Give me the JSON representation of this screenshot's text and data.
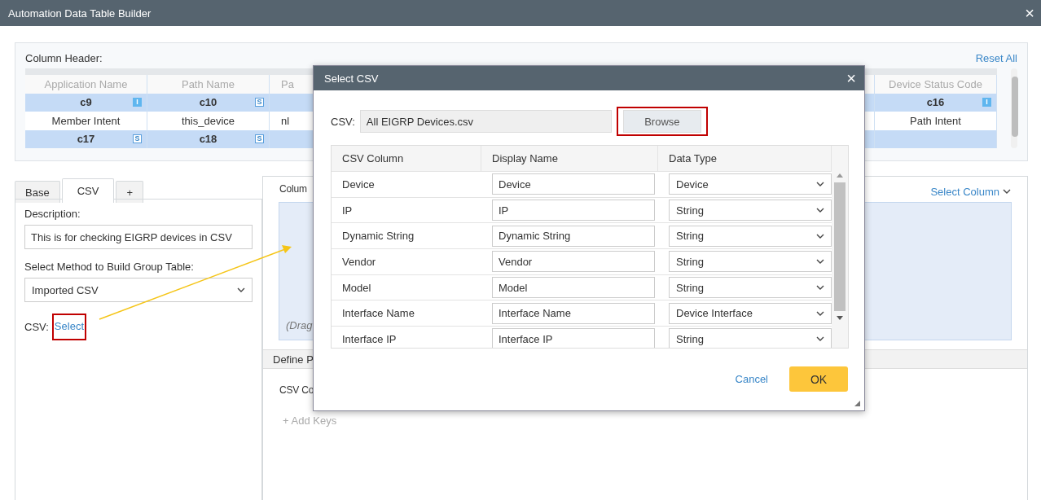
{
  "window": {
    "title": "Automation Data Table Builder",
    "close": "×"
  },
  "column_header": {
    "label": "Column Header:",
    "reset": "Reset All",
    "rows": [
      {
        "kind": "name",
        "cells": [
          {
            "text": "Application Name"
          },
          {
            "text": "Path Name"
          },
          {
            "text": "Pa"
          },
          {
            "text": "Device Status Code"
          }
        ]
      },
      {
        "kind": "var",
        "cells": [
          {
            "text": "c9",
            "badge": "I"
          },
          {
            "text": "c10",
            "badge": "S"
          },
          {
            "text": ""
          },
          {
            "text": "c16",
            "badge": "I"
          }
        ]
      },
      {
        "kind": "value",
        "cells": [
          {
            "text": "Member Intent"
          },
          {
            "text": "this_device"
          },
          {
            "text": "nl"
          },
          {
            "text": "Path Intent"
          }
        ]
      },
      {
        "kind": "var",
        "cells": [
          {
            "text": "c17",
            "badge": "S"
          },
          {
            "text": "c18",
            "badge": "S"
          },
          {
            "text": ""
          },
          {
            "text": ""
          }
        ]
      }
    ]
  },
  "tabs": [
    {
      "label": "Base",
      "selected": false
    },
    {
      "label": "CSV",
      "selected": true
    },
    {
      "label": "+",
      "selected": false
    }
  ],
  "form": {
    "description_label": "Description:",
    "description": "This is for checking EIGRP devices in CSV",
    "method_label": "Select Method to Build Group Table:",
    "method": "Imported CSV",
    "csv_label": "CSV:",
    "csv_link": "Select",
    "csv_link_highlighted": true
  },
  "right_panel": {
    "columns_label": "Colum",
    "select_column": "Select Column",
    "drag_hint": "(Drag",
    "define_tab": "Define P",
    "csv_col_label": "CSV Co",
    "add_keys": "+ Add Keys"
  },
  "dialog": {
    "title": "Select CSV",
    "close": "×",
    "csv_label": "CSV:",
    "csv_file": "All EIGRP Devices.csv",
    "browse": "Browse",
    "browse_highlighted": true,
    "columns": [
      "CSV Column",
      "Display Name",
      "Data Type"
    ],
    "rows": [
      {
        "csv_column": "Device",
        "display_name": "Device",
        "data_type": "Device"
      },
      {
        "csv_column": "IP",
        "display_name": "IP",
        "data_type": "String"
      },
      {
        "csv_column": "Dynamic String",
        "display_name": "Dynamic String",
        "data_type": "String"
      },
      {
        "csv_column": "Vendor",
        "display_name": "Vendor",
        "data_type": "String"
      },
      {
        "csv_column": "Model",
        "display_name": "Model",
        "data_type": "String"
      },
      {
        "csv_column": "Interface Name",
        "display_name": "Interface Name",
        "data_type": "Device Interface"
      },
      {
        "csv_column": "Interface IP",
        "display_name": "Interface IP",
        "data_type": "String"
      }
    ],
    "cancel": "Cancel",
    "ok": "OK"
  }
}
